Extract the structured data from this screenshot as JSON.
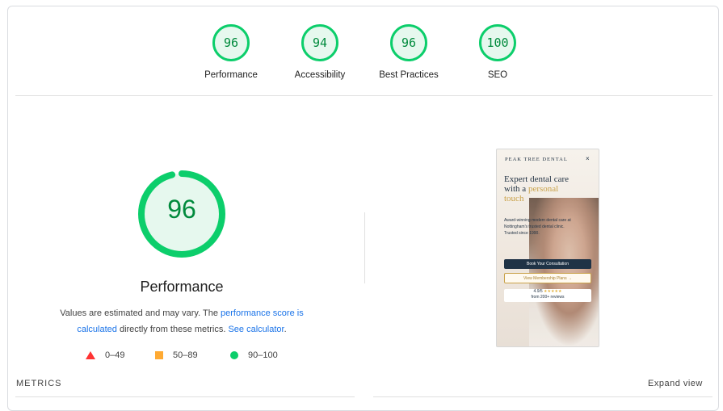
{
  "categories": [
    {
      "score": "96",
      "label": "Performance"
    },
    {
      "score": "94",
      "label": "Accessibility"
    },
    {
      "score": "96",
      "label": "Best Practices"
    },
    {
      "score": "100",
      "label": "SEO"
    }
  ],
  "main": {
    "score": "96",
    "score_fraction": 0.96,
    "title": "Performance",
    "desc_1": "Values are estimated and may vary. The ",
    "desc_link_1": "performance score is calculated",
    "desc_2": " directly from these metrics. ",
    "desc_link_2": "See calculator",
    "desc_3": "."
  },
  "legend": [
    {
      "range": "0–49",
      "shape": "triangle",
      "color": "#ff3333"
    },
    {
      "range": "50–89",
      "shape": "square",
      "color": "#ffaa33"
    },
    {
      "range": "90–100",
      "shape": "circle",
      "color": "#0cce6b"
    }
  ],
  "preview": {
    "brand": "PEAK TREE DENTAL",
    "close": "×",
    "headline_1": "Expert dental care",
    "headline_2": "with a ",
    "headline_gold": "personal",
    "headline_3": "touch",
    "body": "Award-winning modern dental care at Nottingham's trusted dental clinic. Trusted since 1990.",
    "button_primary": "Book Your Consultation",
    "button_secondary": "View Membership Plans →",
    "rating": "4.9/5",
    "stars": "★★★★★",
    "rating_sub": "from 200+ reviews"
  },
  "metrics_label": "METRICS",
  "expand_label": "Expand view",
  "colors": {
    "pass": "#0cce6b",
    "pass_text": "#008a3c",
    "link": "#1a73e8"
  }
}
